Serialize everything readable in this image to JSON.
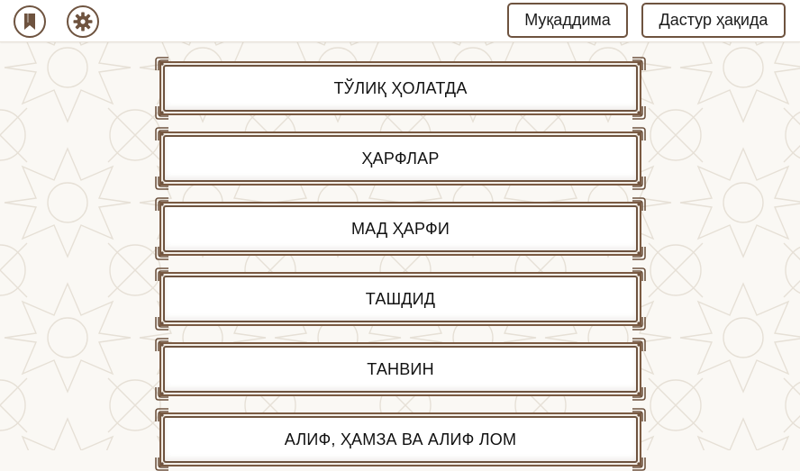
{
  "topbar": {
    "bookmark_icon": "bookmark-icon",
    "settings_icon": "gear-icon",
    "intro_label": "Муқаддима",
    "about_label": "Дастур ҳақида"
  },
  "menu": {
    "items": [
      {
        "label": "ТЎЛИҚ ҲОЛАТДА"
      },
      {
        "label": "ҲАРФЛАР"
      },
      {
        "label": "МАД ҲАРФИ"
      },
      {
        "label": "ТАШДИД"
      },
      {
        "label": "ТАНВИН"
      },
      {
        "label": "АЛИФ, ҲАМЗА ВА АЛИФ ЛОМ"
      }
    ]
  },
  "colors": {
    "accent": "#6e533f",
    "background": "#faf8f4",
    "panel": "#ffffff"
  }
}
